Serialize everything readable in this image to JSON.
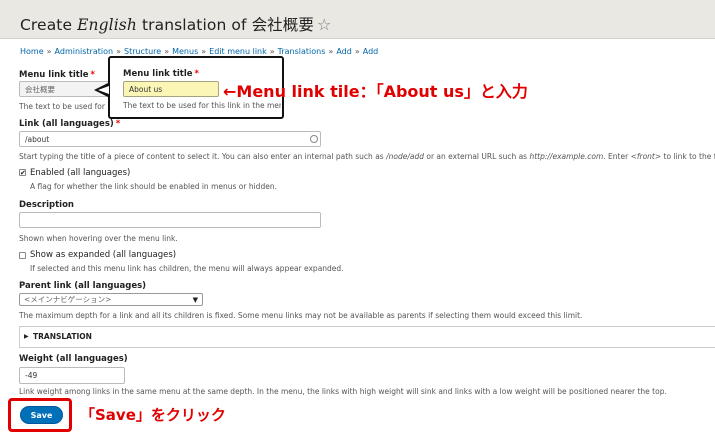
{
  "header": {
    "title_prefix": "Create ",
    "title_em": "English",
    "title_suffix": " translation of 会社概要",
    "star": "☆"
  },
  "breadcrumb": {
    "items": [
      "Home",
      "Administration",
      "Structure",
      "Menus",
      "Edit menu link",
      "Translations",
      "Add",
      "Add"
    ],
    "separator": "»"
  },
  "form": {
    "menu_link_title": {
      "label": "Menu link title",
      "required_mark": "*",
      "value": "会社概要",
      "description": "The text to be used for this link in the menu."
    },
    "callout": {
      "label": "Menu link title",
      "required_mark": "*",
      "value": "About us",
      "description": "The text to be used for this link in the menu."
    },
    "link": {
      "label": "Link (all languages)",
      "required_mark": "*",
      "value": "/about",
      "description_1": "Start typing the title of a piece of content to select it. You can also enter an internal path such as ",
      "description_path": "/node/add",
      "description_2": " or an external URL such as ",
      "description_url": "http://example.com",
      "description_3": ". Enter ",
      "description_front": "<front>",
      "description_4": " to link to the front page."
    },
    "enabled": {
      "label": "Enabled (all languages)",
      "checked": true,
      "description": "A flag for whether the link should be enabled in menus or hidden."
    },
    "description_field": {
      "label": "Description",
      "value": "",
      "description": "Shown when hovering over the menu link."
    },
    "expanded": {
      "label": "Show as expanded (all languages)",
      "checked": false,
      "description": "If selected and this menu link has children, the menu will always appear expanded."
    },
    "parent": {
      "label": "Parent link (all languages)",
      "selected": "<メインナビゲーション>",
      "description": "The maximum depth for a link and all its children is fixed. Some menu links may not be available as parents if selecting them would exceed this limit."
    },
    "translation": {
      "label": "TRANSLATION",
      "toggle": "▶"
    },
    "weight": {
      "label": "Weight (all languages)",
      "value": "-49",
      "description": "Link weight among links in the same menu at the same depth. In the menu, the links with high weight will sink and links with a low weight will be positioned nearer the top."
    },
    "save_label": "Save"
  },
  "annotations": {
    "arrow": "←",
    "title_note": "Menu link tile：「About us」と入力",
    "save_note": "「Save」をクリック",
    "color": "#e00000"
  }
}
